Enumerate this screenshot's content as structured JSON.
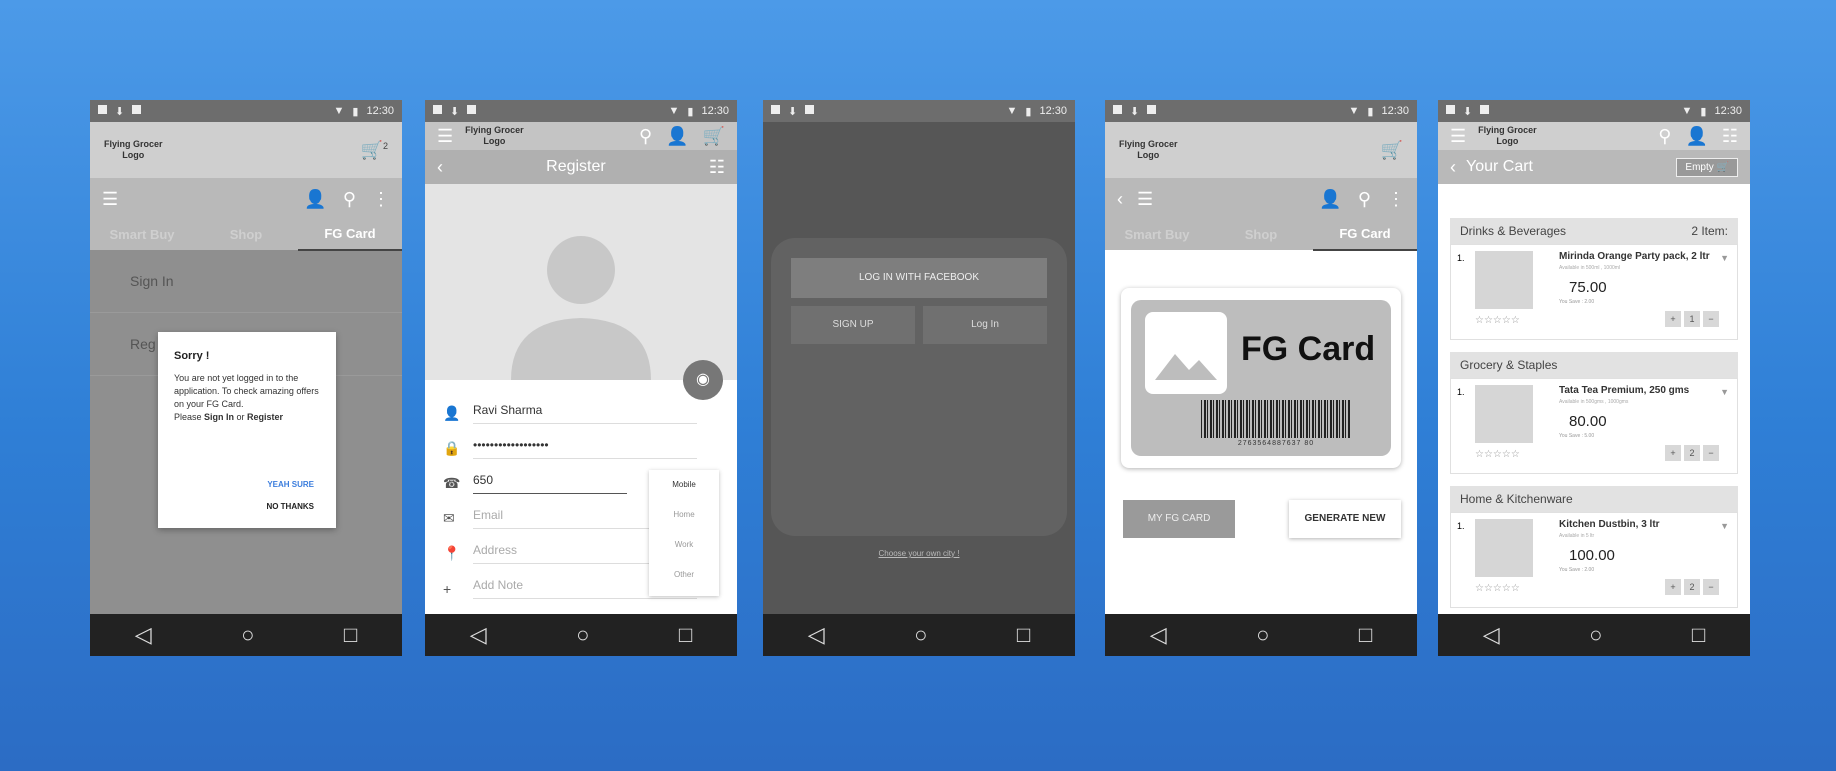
{
  "status": {
    "time": "12:30"
  },
  "logo": {
    "line1": "Flying Grocer",
    "line2": "Logo"
  },
  "cart_count": "2",
  "tabs": [
    "Smart Buy",
    "Shop",
    "FG Card"
  ],
  "nav_icons": [
    "back-triangle",
    "home-circle",
    "recents-square"
  ],
  "screen1": {
    "menu": [
      "Sign In",
      "Reg"
    ],
    "dialog": {
      "title": "Sorry !",
      "body": "You are not yet logged in to the application. To check amazing offers on your FG Card.",
      "body2a": "Please ",
      "body2_signin": "Sign In",
      "body2_or": " or ",
      "body2_register": "Register",
      "yes": "YEAH SURE",
      "no": "NO THANKS"
    }
  },
  "screen2": {
    "title": "Register",
    "name": "Ravi Sharma",
    "password": "••••••••••••••••••",
    "phone": "650",
    "email_ph": "Email",
    "address_ph": "Address",
    "note_ph": "Add Note",
    "phone_types": [
      "Mobile",
      "Home",
      "Work",
      "Other"
    ]
  },
  "screen3": {
    "facebook": "LOG IN WITH FACEBOOK",
    "signup": "SIGN UP",
    "login": "Log In",
    "city": "Choose your own city !"
  },
  "screen4": {
    "card_title": "FG Card",
    "barcode": "2763564887637 80",
    "my_card": "MY FG CARD",
    "generate": "GENERATE NEW"
  },
  "screen5": {
    "title": "Your Cart",
    "empty": "Empty",
    "categories": [
      {
        "name": "Drinks & Beverages",
        "count": "2 Item:"
      },
      {
        "name": "Grocery & Staples",
        "count": ""
      },
      {
        "name": "Home & Kitchenware",
        "count": ""
      }
    ],
    "items": [
      {
        "num": "1.",
        "name": "Mirinda Orange Party pack, 2 ltr",
        "avail": "Available in 500ml , 1000ml",
        "price": "75.00",
        "save": "You Save : 2.00",
        "qty": "1"
      },
      {
        "num": "1.",
        "name": "Tata Tea Premium, 250 gms",
        "avail": "Available in 500gms , 1000gms",
        "price": "80.00",
        "save": "You Save : 5.00",
        "qty": "2"
      },
      {
        "num": "1.",
        "name": "Kitchen Dustbin, 3 ltr",
        "avail": "Available in 5 ltr",
        "price": "100.00",
        "save": "You Save : 2.00",
        "qty": "2"
      }
    ],
    "stars": "☆☆☆☆☆"
  }
}
